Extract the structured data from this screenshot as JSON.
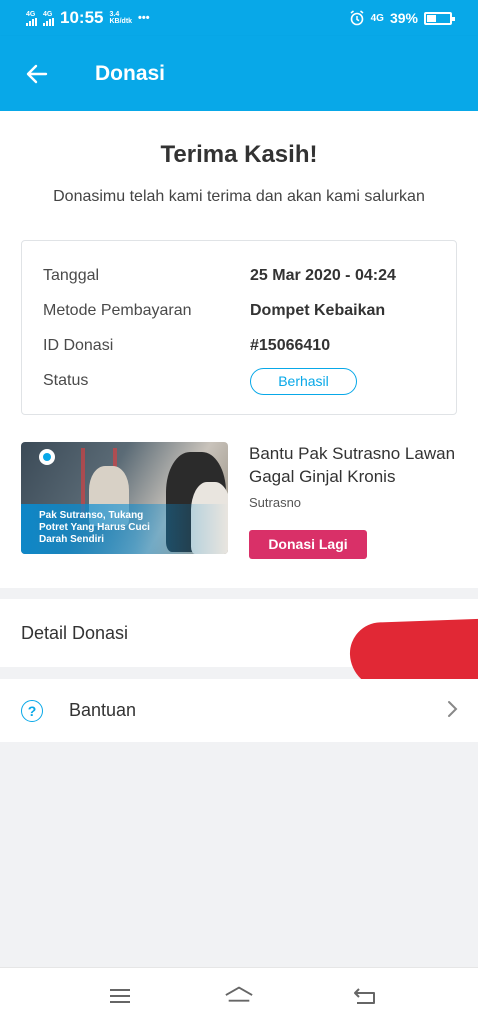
{
  "status_bar": {
    "network_1": "4G",
    "network_2": "4G",
    "time": "10:55",
    "speed_value": "3.4",
    "speed_unit": "KB/dtk",
    "dots": "•••",
    "alarm_icon": "alarm-icon",
    "network_3": "4G",
    "battery_percent": "39%",
    "battery_level": 0.39
  },
  "app_bar": {
    "back_icon": "arrow-left-icon",
    "title": "Donasi"
  },
  "thanks": {
    "title": "Terima Kasih!",
    "subtitle": "Donasimu telah kami terima dan akan kami salurkan"
  },
  "details": {
    "rows": [
      {
        "label": "Tanggal",
        "value": "25 Mar 2020 - 04:24"
      },
      {
        "label": "Metode Pembayaran",
        "value": "Dompet Kebaikan"
      },
      {
        "label": "ID Donasi",
        "value": "#15066410"
      },
      {
        "label": "Status",
        "value": "Berhasil"
      }
    ]
  },
  "campaign": {
    "image_caption": "Pak Sutranso, Tukang Potret Yang Harus Cuci Darah Sendiri",
    "title": "Bantu Pak Sutrasno Lawan Gagal Ginjal Kronis",
    "organizer": "Sutrasno",
    "button_label": "Donasi Lagi"
  },
  "menu": {
    "detail_label": "Detail Donasi",
    "help_label": "Bantuan",
    "help_icon": "question-circle-icon",
    "chevron_icon": "chevron-right-icon"
  },
  "nav_bar": {
    "menu_icon": "menu-icon",
    "home_icon": "home-icon",
    "back_icon": "back-icon"
  },
  "colors": {
    "primary": "#08a8e8",
    "accent": "#d93068",
    "redaction": "#e12835"
  }
}
